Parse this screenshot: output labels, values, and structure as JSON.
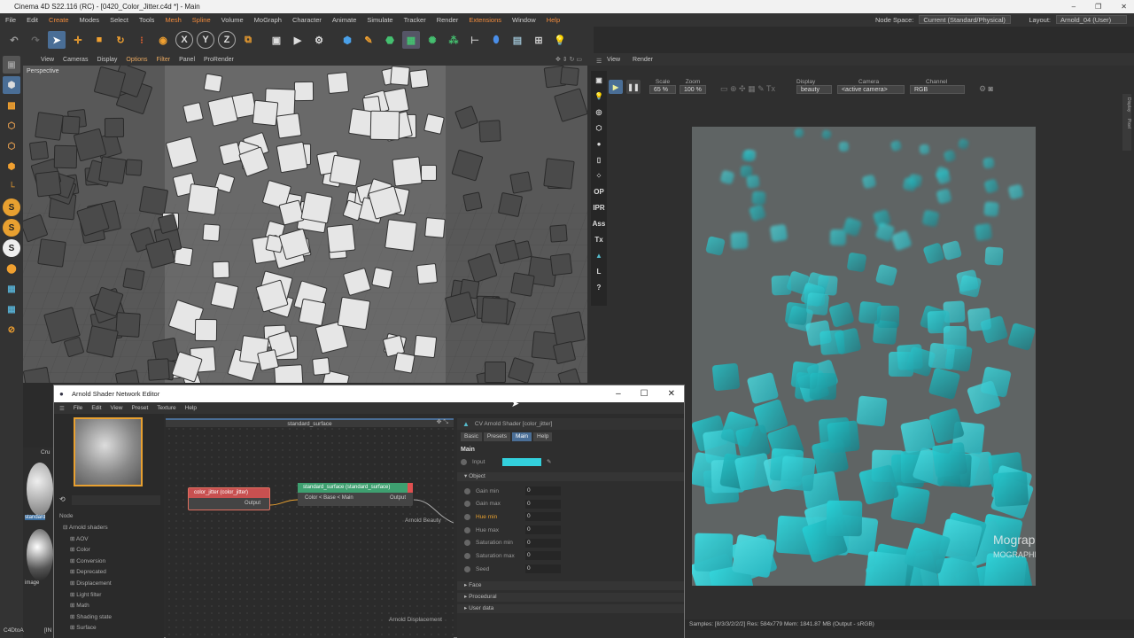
{
  "app": {
    "title": "Cinema 4D S22.116 (RC) - [0420_Color_Jitter.c4d *] - Main",
    "window_buttons": [
      "–",
      "❐",
      "✕"
    ]
  },
  "menu": [
    "File",
    "Edit",
    "Create",
    "Modes",
    "Select",
    "Tools",
    "Mesh",
    "Spline",
    "Volume",
    "MoGraph",
    "Character",
    "Animate",
    "Simulate",
    "Tracker",
    "Render",
    "Extensions",
    "Window",
    "Help"
  ],
  "node_space": {
    "label": "Node Space:",
    "value": "Current (Standard/Physical)",
    "layout_label": "Layout:",
    "layout_value": "Arnold_04 (User)"
  },
  "viewport": {
    "menu": [
      "View",
      "Cameras",
      "Display",
      "Options",
      "Filter",
      "Panel",
      "ProRender"
    ],
    "label": "Perspective"
  },
  "render_view": {
    "menu": [
      "View",
      "Render"
    ],
    "scale_label": "Scale",
    "scale_value": "65 %",
    "zoom_label": "Zoom",
    "zoom_value": "100 %",
    "display_label": "Display",
    "display_value": "beauty",
    "camera_label": "Camera",
    "camera_value": "<active camera>",
    "channel_label": "Channel",
    "channel_value": "RGB",
    "side_tabs": [
      "Display",
      "Pixel"
    ],
    "tools": [
      "OP",
      "IPR",
      "Ass",
      "Tx",
      "L",
      "?"
    ],
    "watermark": "MographPlus",
    "watermark_url": "MOGRAPHPLUS.COM",
    "status": "Samples: [8/3/3/2/2/2]  Res: 584x779  Mem: 1841.87 MB  (Output - sRGB)",
    "accent": "#35c8cc"
  },
  "left_panel": {
    "label_cr": "Cru",
    "label_standard": "standard",
    "label_image": "image",
    "label_c4dtoa": "C4DtoA",
    "label_in": "[IN"
  },
  "shader_editor": {
    "title": "Arnold Shader Network Editor",
    "menu": [
      "File",
      "Edit",
      "View",
      "Preset",
      "Texture",
      "Help"
    ],
    "tree_header": "Node",
    "tree": [
      "Arnold shaders",
      "AOV",
      "Color",
      "Conversion",
      "Deprecated",
      "Displacement",
      "Light filter",
      "Math",
      "Shading state",
      "Surface"
    ],
    "graph_title": "standard_surface",
    "node_jitter": {
      "title": "color_jitter (color_jitter)",
      "output": "Output"
    },
    "node_surface": {
      "title": "standard_surface (standard_surface)",
      "input": "Color < Base < Main",
      "output": "Output"
    },
    "beauty": "Arnold Beauty",
    "displacement": "Arnold Displacement",
    "attr_title": "CV Arnold Shader [color_jitter]",
    "tabs": [
      "Basic",
      "Presets",
      "Main",
      "Help"
    ],
    "section_main": "Main",
    "input_label": "Input",
    "input_color": "#33d0dc",
    "group_object": "Object",
    "props": [
      {
        "label": "Gain min",
        "value": "0"
      },
      {
        "label": "Gain max",
        "value": "0"
      },
      {
        "label": "Hue min",
        "value": "0"
      },
      {
        "label": "Hue max",
        "value": "0"
      },
      {
        "label": "Saturation min",
        "value": "0"
      },
      {
        "label": "Saturation max",
        "value": "0"
      },
      {
        "label": "Seed",
        "value": "0"
      }
    ],
    "groups": [
      "Face",
      "Procedural",
      "User data"
    ]
  }
}
